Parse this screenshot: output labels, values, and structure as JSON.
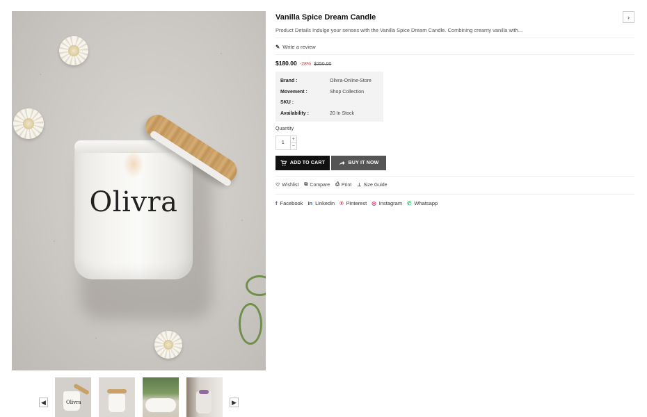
{
  "product": {
    "title": "Vanilla Spice Dream Candle",
    "description": "Product Details Indulge your senses with the Vanilla Spice Dream Candle. Combining creamy vanilla with...",
    "jar_logo": "Olivra",
    "thumb_logo": "Olivra",
    "review_label": "Write a review",
    "price": "$180.00",
    "discount": "-28%",
    "old_price": "$250.00"
  },
  "specs": [
    {
      "key": "Brand :",
      "value": "Olivra-Online-Store"
    },
    {
      "key": "Movement :",
      "value": "Shop Collection"
    },
    {
      "key": "SKU :",
      "value": ""
    },
    {
      "key": "Availability :",
      "value": "20 In Stock"
    }
  ],
  "quantity": {
    "label": "Quantity",
    "value": "1",
    "plus": "+",
    "minus": "−"
  },
  "buttons": {
    "add_to_cart": "ADD TO CART",
    "buy_now": "BUY IT NOW"
  },
  "actions": [
    "Wishlist",
    "Compare",
    "Print",
    "Size Guide"
  ],
  "social": [
    {
      "label": "Facebook",
      "icon": "facebook-icon",
      "color": "#3b5998"
    },
    {
      "label": "Linkedin",
      "icon": "linkedin-icon",
      "color": "#0a66c2"
    },
    {
      "label": "Pinterest",
      "icon": "pinterest-icon",
      "color": "#c8232c"
    },
    {
      "label": "Instagram",
      "icon": "instagram-icon",
      "color": "#d62976"
    },
    {
      "label": "Whatsapp",
      "icon": "whatsapp-icon",
      "color": "#25d366"
    }
  ],
  "colors": {
    "price_discount": "#d23c3c",
    "cart_button": "#111111",
    "buy_button": "#555555"
  }
}
